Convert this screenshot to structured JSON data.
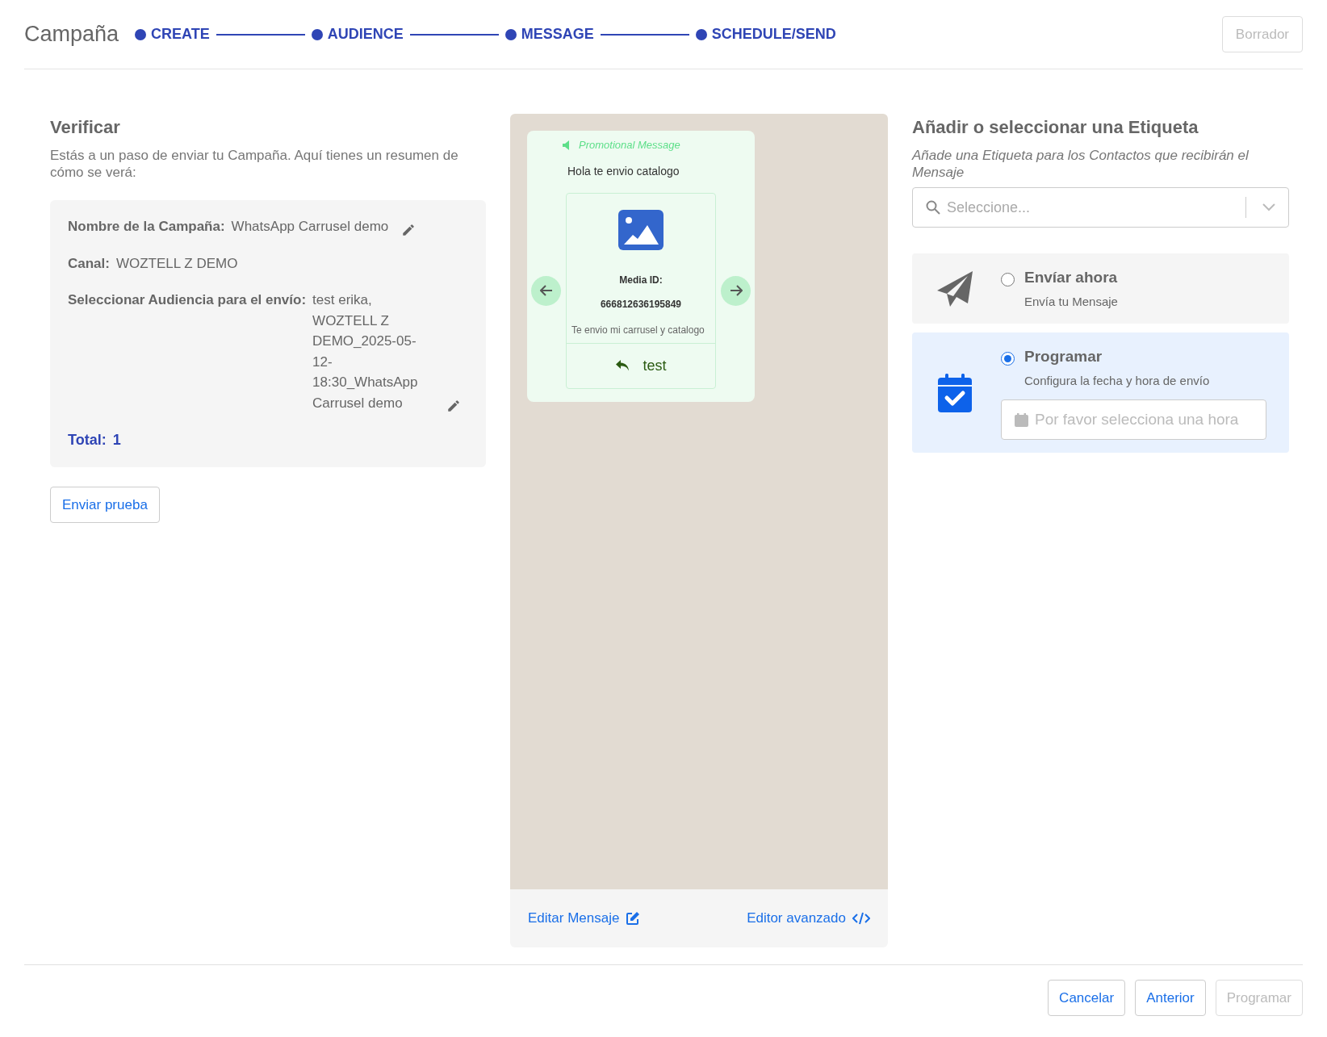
{
  "header": {
    "title": "Campaña",
    "steps": [
      {
        "label": "CREATE",
        "completed": true
      },
      {
        "label": "AUDIENCE",
        "completed": true
      },
      {
        "label": "MESSAGE",
        "completed": true
      },
      {
        "label": "SCHEDULE/SEND",
        "completed": true
      }
    ],
    "draft_button": {
      "label": "Borrador",
      "disabled": true
    }
  },
  "verify": {
    "title": "Verificar",
    "description": "Estás a un paso de enviar tu Campaña. Aquí tienes un resumen de cómo se verá:",
    "summary": [
      {
        "label": "Nombre de la Campaña:",
        "value": "WhatsApp Carrusel demo",
        "editable": true
      },
      {
        "label": "Canal:",
        "value": "WOZTELL Z DEMO",
        "editable": false
      },
      {
        "label": "Seleccionar Audiencia para el envío:",
        "value": "test erika, WOZTELL Z DEMO_2025-05-12-18:30_WhatsApp Carrusel demo",
        "editable": true
      }
    ],
    "total_label": "Total:",
    "total_value": "1",
    "test_button": "Enviar prueba"
  },
  "preview": {
    "tag": "Promotional Message",
    "body": "Hola te envio catalogo",
    "card": {
      "media_label": "Media ID:",
      "media_id": "666812636195849",
      "caption": "Te envio mi carrusel y catalogo",
      "reply_button": "test"
    },
    "edit_link": "Editar Mensaje",
    "advanced_link": "Editor avanzado"
  },
  "tagging": {
    "title": "Añadir o seleccionar una Etiqueta",
    "hint": "Añade una Etiqueta para los Contactos que recibirán el Mensaje",
    "select": {
      "placeholder": "Seleccione..."
    }
  },
  "send_options": [
    {
      "kind": "now",
      "title": "Envíar ahora",
      "subtitle": "Envía tu Mensaje",
      "selected": false
    },
    {
      "kind": "schedule",
      "title": "Programar",
      "subtitle": "Configura la fecha y hora de envío",
      "selected": true,
      "time_field": {
        "placeholder": "Por favor selecciona una hora"
      }
    }
  ],
  "footer": [
    {
      "label": "Cancelar",
      "disabled": false
    },
    {
      "label": "Anterior",
      "disabled": false
    },
    {
      "label": "Programar",
      "disabled": true
    }
  ]
}
